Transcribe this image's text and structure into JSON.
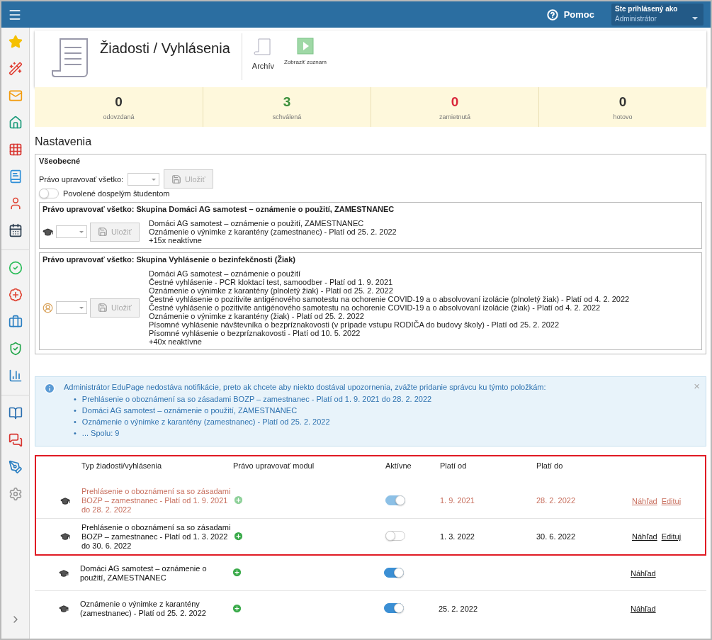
{
  "topbar": {
    "help_label": "Pomoc",
    "user_caption": "Ste prihlásený ako",
    "user_role": "Administrátor"
  },
  "header": {
    "title": "Žiadosti / Vyhlásenia",
    "actions": [
      {
        "kind": "archive",
        "label": "Archív"
      },
      {
        "kind": "list",
        "label": "Zobraziť zoznam"
      }
    ]
  },
  "stats": [
    {
      "value": "0",
      "label": "odovzdaná",
      "color": "#333333"
    },
    {
      "value": "3",
      "label": "schválená",
      "color": "#3a8f3a"
    },
    {
      "value": "0",
      "label": "zamietnutá",
      "color": "#d9263a"
    },
    {
      "value": "0",
      "label": "hotovo",
      "color": "#333333"
    }
  ],
  "settings": {
    "title": "Nastavenia",
    "general": {
      "title": "Všeobecné",
      "edit_label": "Právo upravovať všetko:",
      "save": {
        "label": "Uložiť",
        "disabled": true
      },
      "adult_toggle": {
        "label": "Povolené dospelým študentom",
        "on": false
      }
    },
    "groups": [
      {
        "title": "Právo upravovať všetko: Skupina Domáci AG samotest – oznámenie o použití, ZAMESTNANEC",
        "kind": "cap",
        "save": {
          "label": "Uložiť",
          "disabled": true
        },
        "items": [
          "Domáci AG samotest – oznámenie o použití, ZAMESTNANEC",
          "Oznámenie o výnimke z karantény (zamestnanec) - Platí od 25. 2. 2022",
          "+15x neaktívne"
        ]
      },
      {
        "title": "Právo upravovať všetko: Skupina Vyhlásenie o bezinfekčnosti (Žiak)",
        "kind": "person",
        "save": {
          "label": "Uložiť",
          "disabled": true
        },
        "items": [
          "Domáci AG samotest – oznámenie o použití",
          "Čestné vyhlásenie - PCR kloktací test, samoodber - Platí od 1. 9. 2021",
          "Oznámenie o výnimke z karantény (plnoletý žiak) - Platí od 25. 2. 2022",
          "Čestné vyhlásenie o pozitivite antigénového samotestu na ochorenie COVID-19 a o absolvovaní izolácie (plnoletý žiak) - Platí od 4. 2. 2022",
          "Čestné vyhlásenie o pozitivite antigénového samotestu na ochorenie COVID-19 a o absolvovaní izolácie (žiak) - Platí od 4. 2. 2022",
          "Oznámenie o výnimke z karantény (žiak) - Platí od 25. 2. 2022",
          "Písomné vyhlásenie návštevníka o bezpríznakovosti (v prípade vstupu RODIČA do budovy školy) - Platí od 25. 2. 2022",
          "Písomné vyhlásenie o bezpríznakovosti - Platí od 10. 5. 2022",
          "+40x neaktívne"
        ]
      }
    ]
  },
  "notice": {
    "text": "Administrátor EduPage nedostáva notifikácie, preto ak chcete aby niekto dostával upozornenia, zvážte pridanie správcu ku týmto položkám:",
    "items": [
      "Prehlásenie o oboznámení sa so zásadami BOZP – zamestnanec - Platí od 1. 9. 2021 do 28. 2. 2022",
      "Domáci AG samotest – oznámenie o použití, ZAMESTNANEC",
      "Oznámenie o výnimke z karantény (zamestnanec) - Platí od 25. 2. 2022",
      "... Spolu: 9"
    ],
    "bullet": "•",
    "close": "×"
  },
  "table": {
    "header_highlighted": true,
    "columns": [
      "Typ žiadosti/vyhlásenia",
      "Právo upravovať modul",
      "Aktívne",
      "Platí od",
      "Platí do"
    ],
    "rows": [
      {
        "type": "Prehlásenie o oboznámení sa so zásadami BOZP – zamestnanec - Platí od 1. 9. 2021 do 28. 2. 2022",
        "expired": true,
        "highlighted": true,
        "active": true,
        "valid_from": "1. 9. 2021",
        "valid_to": "28. 2. 2022",
        "links": [
          "Náhľad",
          "Edituj"
        ]
      },
      {
        "type": "Prehlásenie o oboznámení sa so zásadami BOZP – zamestnanec - Platí od 1. 3. 2022 do 30. 6. 2022",
        "expired": false,
        "highlighted": true,
        "active": false,
        "valid_from": "1. 3. 2022",
        "valid_to": "30. 6. 2022",
        "links": [
          "Náhľad",
          "Edituj"
        ]
      },
      {
        "type": "Domáci AG samotest – oznámenie o použití, ZAMESTNANEC",
        "expired": false,
        "highlighted": false,
        "active": true,
        "links": [
          "Náhľad"
        ]
      },
      {
        "type": "Oznámenie o výnimke z karantény (zamestnanec) - Platí od 25. 2. 2022",
        "expired": false,
        "highlighted": false,
        "active": true,
        "valid_from": "25. 2. 2022",
        "links": [
          "Náhľad"
        ]
      }
    ]
  }
}
